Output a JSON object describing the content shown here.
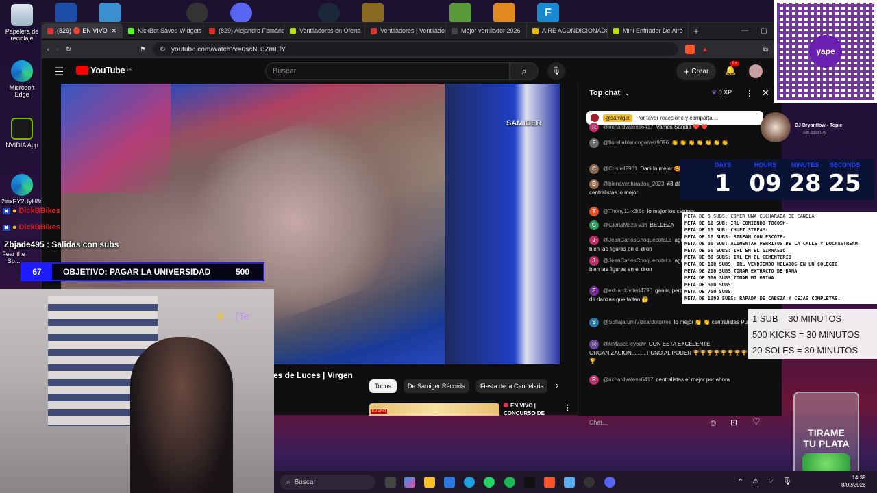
{
  "desktop": {
    "icons": [
      {
        "label": "Papelera de reciclaje"
      },
      {
        "label": "Microsoft Edge"
      },
      {
        "label": "NVIDIA App"
      },
      {
        "label": "2inxPY2UyH8ri..."
      },
      {
        "label": "Fear the Sp..."
      }
    ]
  },
  "browser": {
    "tabs": [
      {
        "label": "(829) 🔴 EN VIVO",
        "color": "#e03030"
      },
      {
        "label": "KickBot Saved Widgets",
        "color": "#53fc18"
      },
      {
        "label": "(829) Alejandro Fernánd",
        "color": "#e03030"
      },
      {
        "label": "Ventiladores en Oferta",
        "color": "#b7e000"
      },
      {
        "label": "Ventiladores | Ventilador",
        "color": "#e03030"
      },
      {
        "label": "Mejor ventilador 2026",
        "color": "#222222"
      },
      {
        "label": "AIRE ACONDICIONADO",
        "color": "#e6b800"
      },
      {
        "label": "Mini Enfriador De Aire",
        "color": "#b7e000"
      }
    ],
    "url": "youtube.com/watch?v=0scNu8ZmEfY"
  },
  "youtube": {
    "logo": "YouTube",
    "country": "PE",
    "search_placeholder": "Buscar",
    "create_label": "Crear",
    "notif_count": "9+",
    "video_title": "es de Luces | Virgen",
    "watermark": "SAMIGER",
    "chips": [
      "Todos",
      "De Samiger Récords",
      "Fiesta de la Candelaria"
    ],
    "rec_title": "EN VIVO | CONCURSO DE",
    "rec_thumb_badge": "EN VIVO"
  },
  "chat": {
    "title": "Top chat",
    "xp": "0 XP",
    "pinned_user": "@samiger",
    "pinned_text": "Por favor reaccione y comparta ...",
    "input_placeholder": "Chat...",
    "messages": [
      {
        "initial": "R",
        "color": "#c0306a",
        "author": "@richardvalens6417",
        "text": "Vamos Sandia ❤️ ❤️"
      },
      {
        "initial": "F",
        "color": "#6a6a6a",
        "author": "@fiorellablancogalvez9096",
        "text": "👏 👏 👏 👏 👏 👏 👏"
      },
      {
        "initial": "C",
        "color": "#8a6a50",
        "author": "@Cristell2901",
        "text": "Dani la mejor 🥰"
      },
      {
        "initial": "B",
        "color": "#a07050",
        "author": "@bienaventurados_2023",
        "text": "#3 déjenme llorar 😭 😭 centralistas lo mejor"
      },
      {
        "initial": "T",
        "color": "#e0502a",
        "author": "@Thony11-x3t6c",
        "text": "lo mejor los centras"
      },
      {
        "initial": "G",
        "color": "#2a9a5a",
        "author": "@GloriaMeza-v3n",
        "text": "BELLEZA"
      },
      {
        "initial": "J",
        "color": "#c0306a",
        "author": "@JeanCarlosChoquecotaLa",
        "text": "agua no se que sea arruina t ve bien las figuras en el dron"
      },
      {
        "initial": "J",
        "color": "#c0306a",
        "author": "@JeanCarlosChoquecotaLa",
        "text": "agua no se que sea arruina t ve bien las figuras en el dron"
      },
      {
        "initial": "E",
        "color": "#7a2aa0",
        "author": "@eduardoviteri4796",
        "text": "ganar, pero hay que ver qué conjuntos de danzas que faltan 🤔"
      },
      {
        "initial": "S",
        "color": "#2a7ab0",
        "author": "@SofiajarumiVizcardotorres",
        "text": "lo mejor 👏 👏 centralistas Puno"
      },
      {
        "initial": "R",
        "color": "#6a4aa0",
        "author": "@RMasco-cy6dw",
        "text": "CON ESTA EXCELENTE ORGANIZACION......... PUNO AL PODER 🏆🏆🏆🏆🏆🏆🏆🏆🏆"
      },
      {
        "initial": "R",
        "color": "#c0306a",
        "author": "@richardvalens6417",
        "text": "centralistas el mejor por ahora"
      }
    ]
  },
  "overlay": {
    "alerts": [
      {
        "user": "DickBBikes"
      },
      {
        "user": "DickBBikes"
      }
    ],
    "subs_text": "Zbjade495 : Salidas con subs",
    "objective_count": "67",
    "objective_label": "OBJETIVO: PAGAR LA UNIVERSIDAD",
    "objective_target": "500",
    "crown_text": "{Te",
    "music": {
      "title": "DJ Bryanflow - Topic",
      "subtitle": "San Judas City"
    },
    "countdown": {
      "labels": [
        "DAYS",
        "HOURS",
        "MINUTES",
        "SECONDS"
      ],
      "values": [
        "1",
        "09",
        "28",
        "25"
      ]
    },
    "goals": [
      "META DE 5 SUBS: COMER UNA CUCHARADA DE CANELA",
      "META DE 10 SUB: IRL COMIENDO TOCOSH-",
      "META DE 15 SUB: CHUPI STREAM-",
      "META DE 18 SUBS: STREAM CON ESCOTE-",
      "META DE 30 SUB:  ALIMENTAR PERRITOS DE LA CALLE Y DUCHASTREAM",
      "META DE 50 SUBS: IRL EN EL GIMNASIO",
      "META DE 80 SUBS: IRL EN EL CEMENTERIO",
      "META DE 100 SUBS: IRL VENDIENDO HELADOS EN UN COLEGIO",
      "META DE 200 SUBS:TOMAR EXTRACTO DE RANA",
      "META DE 300 SUBS:TOMAR MI ORINA",
      "META DE 500 SUBS:",
      "META DE 750 SUBS:",
      "META DE 1000 SUBS: RAPADA DE CABEZA Y CEJAS COMPLETAS."
    ],
    "rates": [
      "1 SUB = 30 MINUTOS",
      "500 KICKS = 30 MINUTOS",
      "20 SOLES = 30 MINUTOS"
    ],
    "jar_text": [
      "TIRAME",
      "TU PLATA"
    ],
    "qr_label": "yape"
  },
  "taskbar": {
    "search_placeholder": "Buscar",
    "time": "14:39",
    "date": "8/02/2026"
  }
}
